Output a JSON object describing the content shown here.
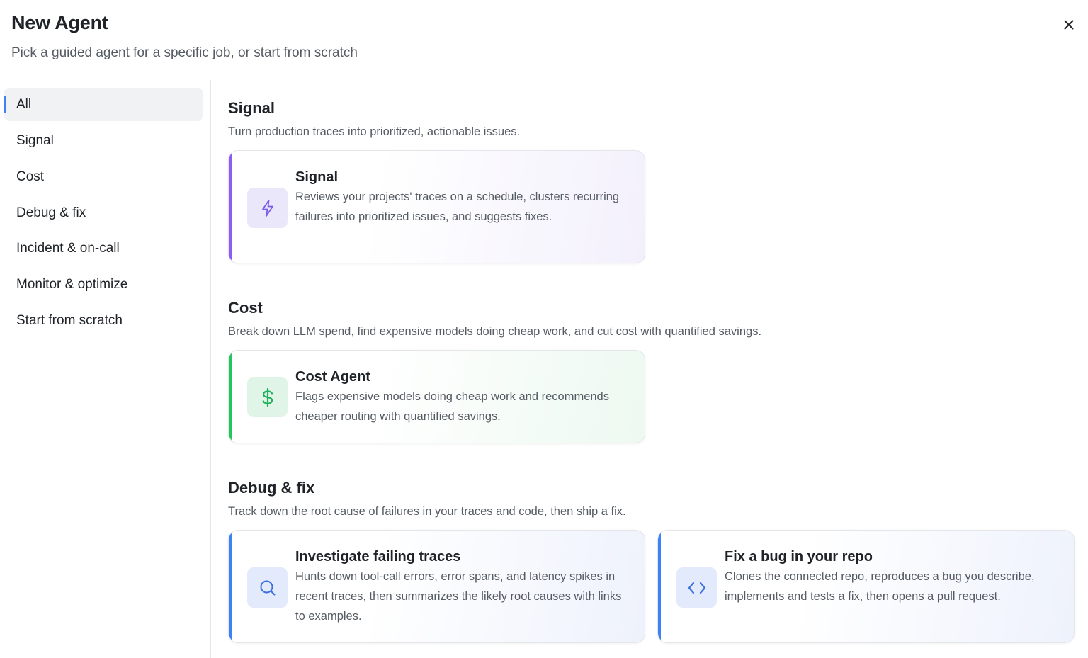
{
  "header": {
    "title": "New Agent",
    "subtitle": "Pick a guided agent for a specific job, or start from scratch",
    "close_icon": "close-icon"
  },
  "sidebar": {
    "items": [
      {
        "label": "All",
        "active": true
      },
      {
        "label": "Signal"
      },
      {
        "label": "Cost"
      },
      {
        "label": "Debug & fix"
      },
      {
        "label": "Incident & on-call"
      },
      {
        "label": "Monitor & optimize"
      },
      {
        "label": "Start from scratch"
      }
    ]
  },
  "sections": [
    {
      "title": "Signal",
      "description": "Turn production traces into prioritized, actionable issues.",
      "cards": [
        {
          "title": "Signal",
          "description": "Reviews your projects' traces on a schedule, clusters recurring failures into prioritized issues, and suggests fixes.",
          "icon": "lightning-icon",
          "accent": "#8b5cf6"
        }
      ]
    },
    {
      "title": "Cost",
      "description": "Break down LLM spend, find expensive models doing cheap work, and cut cost with quantified savings.",
      "cards": [
        {
          "title": "Cost Agent",
          "description": "Flags expensive models doing cheap work and recommends cheaper routing with quantified savings.",
          "icon": "dollar-icon",
          "accent": "#22c55e"
        }
      ]
    },
    {
      "title": "Debug & fix",
      "description": "Track down the root cause of failures in your traces and code, then ship a fix.",
      "cards": [
        {
          "title": "Investigate failing traces",
          "description": "Hunts down tool-call errors, error spans, and latency spikes in recent traces, then summarizes the likely root causes with links to examples.",
          "icon": "search-icon",
          "accent": "#3b82f6"
        },
        {
          "title": "Fix a bug in your repo",
          "description": "Clones the connected repo, reproduces a bug you describe, implements and tests a fix, then opens a pull request.",
          "icon": "code-icon",
          "accent": "#3b82f6"
        }
      ]
    }
  ]
}
